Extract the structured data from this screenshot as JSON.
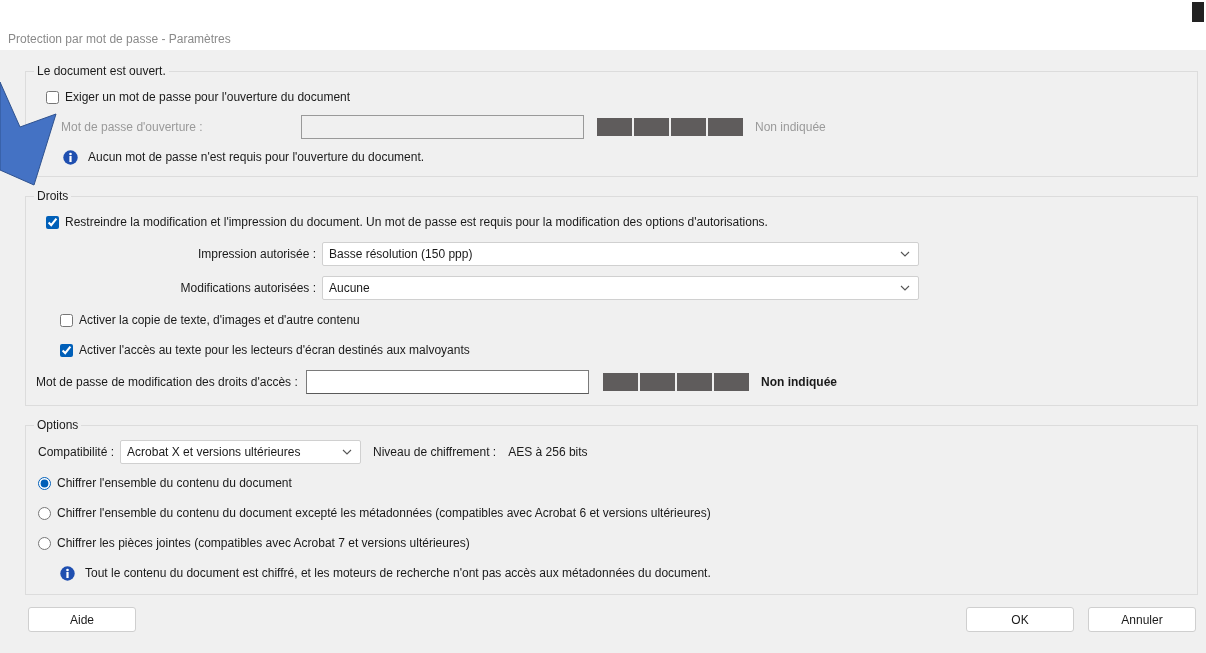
{
  "window": {
    "title": "Protection par mot de passe - Paramètres"
  },
  "open_section": {
    "legend": "Le document est ouvert.",
    "require_password": {
      "label": "Exiger un mot de passe pour l'ouverture du document",
      "checked": false
    },
    "password": {
      "label": "Mot de passe d'ouverture :",
      "disabled": true,
      "strength": "Non indiquée"
    },
    "info": "Aucun mot de passe n'est requis pour l'ouverture du document."
  },
  "rights_section": {
    "legend": "Droits",
    "restrict": {
      "label": "Restreindre la modification et l'impression du document. Un mot de passe est requis pour la modification des options d'autorisations.",
      "checked": true
    },
    "selects": [
      {
        "label": "Impression autorisée :",
        "value": "Basse résolution (150 ppp)"
      },
      {
        "label": "Modifications autorisées :",
        "value": "Aucune"
      }
    ],
    "checkboxes": [
      {
        "label": "Activer la copie de texte, d'images et d'autre contenu",
        "checked": false
      },
      {
        "label": "Activer l'accès au texte pour les lecteurs d'écran destinés aux malvoyants",
        "checked": true
      }
    ],
    "password": {
      "label": "Mot de passe de modification des droits d'accès :",
      "disabled": false,
      "strength": "Non indiquée"
    }
  },
  "options_section": {
    "legend": "Options",
    "compatibility": {
      "label": "Compatibilité :",
      "value": "Acrobat X et versions ultérieures"
    },
    "encryption": {
      "label": "Niveau de chiffrement :",
      "value": "AES à 256 bits"
    },
    "radios": [
      {
        "label": "Chiffrer l'ensemble du contenu du document",
        "selected": true
      },
      {
        "label": "Chiffrer l'ensemble du contenu du document excepté les métadonnées (compatibles avec Acrobat 6 et versions ultérieures)",
        "selected": false
      },
      {
        "label": "Chiffrer les pièces jointes (compatibles avec Acrobat 7 et versions ultérieures)",
        "selected": false
      }
    ],
    "info": "Tout le contenu du document est chiffré, et les moteurs de recherche n'ont pas accès aux métadonnées du document."
  },
  "buttons": [
    {
      "label": "Aide"
    },
    {
      "label": "OK"
    },
    {
      "label": "Annuler"
    }
  ]
}
